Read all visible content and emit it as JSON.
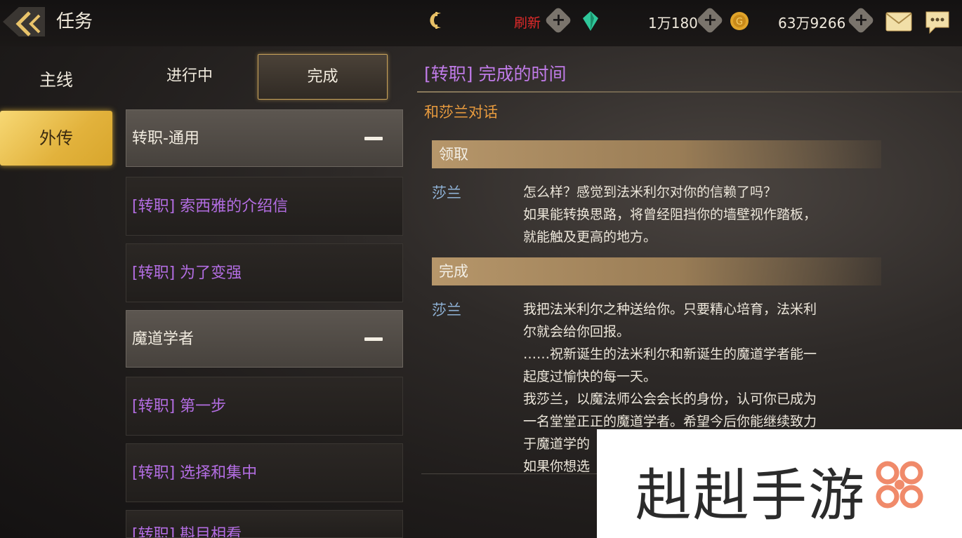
{
  "header": {
    "title": "任务",
    "refresh_label": "刷新",
    "gems_amount": "1万180",
    "gold_amount": "63万9266"
  },
  "sidebar": {
    "items": [
      {
        "label": "主线",
        "selected": false
      },
      {
        "label": "外传",
        "selected": true
      }
    ]
  },
  "tabs": {
    "in_progress": "进行中",
    "done": "完成"
  },
  "quest_list": {
    "groups": [
      {
        "label": "转职-通用",
        "quests": [
          "[转职] 索西雅的介绍信",
          "[转职] 为了变强"
        ]
      },
      {
        "label": "魔道学者",
        "quests": [
          "[转职] 第一步",
          "[转职] 选择和集中",
          "[转职] 斟目相看"
        ]
      }
    ]
  },
  "detail": {
    "title": "[转职] 完成的时间",
    "subtitle": "和莎兰对话",
    "sections": [
      {
        "header": "领取",
        "speaker": "莎兰",
        "lines": [
          "怎么样？感觉到法米利尔对你的信赖了吗？",
          "如果能转换思路，将曾经阻挡你的墙壁视作踏板，",
          "就能触及更高的地方。"
        ]
      },
      {
        "header": "完成",
        "speaker": "莎兰",
        "lines": [
          "我把法米利尔之种送给你。只要精心培育，法米利",
          "尔就会给你回报。",
          "……祝新诞生的法米利尔和新诞生的魔道学者能一",
          "起度过愉快的每一天。",
          "我莎兰，以魔法师公会会长的身份，认可你已成为",
          "一名堂堂正正的魔道学者。希望今后你能继续致力",
          "于魔道学的",
          "如果你想选"
        ]
      }
    ]
  },
  "watermark": {
    "text": "赳赳手游"
  },
  "colors": {
    "accent_gold": "#e2b23c",
    "quest_purple": "#b36de2",
    "subtitle_orange": "#e89b3e",
    "speaker_blue": "#8fb2d6",
    "refresh_red": "#e02a2a"
  }
}
